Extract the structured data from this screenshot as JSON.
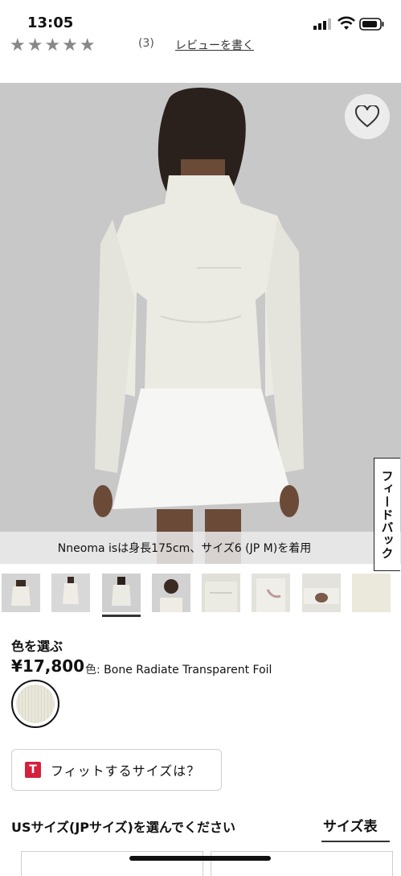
{
  "status_bar": {
    "time": "13:05"
  },
  "rating_row": {
    "stars": "★★★★★",
    "count": "(3)",
    "write_review": "レビューを書く"
  },
  "hero": {
    "caption": "Nneoma isは身長175cm、サイズ6 (JP M)を着用"
  },
  "feedback": {
    "label": "フィードバック"
  },
  "product": {
    "color_label": "色を選ぶ",
    "price": "¥17,800",
    "color_prefix": "色: ",
    "color_name": "Bone Radiate Transparent Foil",
    "swatch_color": "#e6e3d6"
  },
  "fit_button": {
    "icon_letter": "T",
    "label": "フィットするサイズは？"
  },
  "size_section": {
    "heading": "USサイズ(JPサイズ)を選んでください",
    "chart_link": "サイズ表"
  },
  "colors": {
    "accent_red": "#d6203e",
    "hero_bg": "#c9c9c9"
  }
}
